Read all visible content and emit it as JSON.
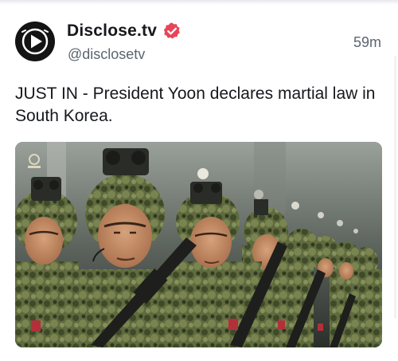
{
  "post": {
    "author": {
      "display_name": "Disclose.tv",
      "handle": "@disclosetv",
      "verified": true,
      "avatar_icon": "play-logo-icon"
    },
    "timestamp": "59m",
    "text": "JUST IN - President Yoon declares martial law in South Korea.",
    "media": {
      "type": "photo",
      "subject": "soldiers-in-formation"
    }
  },
  "colors": {
    "text_primary": "#16181c",
    "text_secondary": "#5b6470",
    "verified_badge": "#e8455a"
  }
}
